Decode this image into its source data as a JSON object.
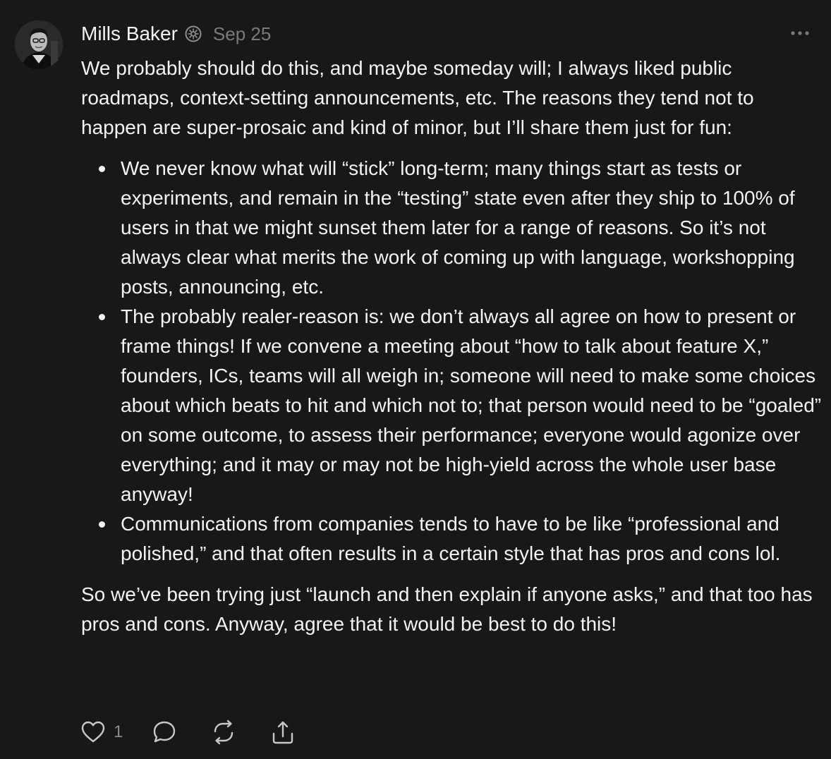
{
  "author": {
    "name": "Mills Baker",
    "date": "Sep 25",
    "verified": true
  },
  "post": {
    "intro": "We probably should do this, and maybe someday will; I always liked public roadmaps, context-setting announcements, etc. The reasons they tend not to happen are super-prosaic and kind of minor, but I’ll share them just for fun:",
    "bullets": [
      "We never know what will “stick” long-term; many things start as tests or experiments, and remain in the “testing” state even after they ship to 100% of users in that we might sunset them later for a range of reasons. So it’s not always clear what merits the work of coming up with language, workshopping posts, announcing, etc.",
      "The probably realer-reason is: we don’t always all agree on how to present or frame things! If we convene a meeting about “how to talk about feature X,” founders, ICs, teams will all weigh in; someone will need to make some choices about which beats to hit and which not to; that person would need to be “goaled” on some outcome, to assess their performance; everyone would agonize over everything; and it may or may not be high-yield across the whole user base anyway!",
      "Communications from companies tends to have to be like “professional and polished,” and that often results in a certain style that has pros and cons lol."
    ],
    "outro": "So we’ve been trying just “launch and then explain if anyone asks,” and that too has pros and cons. Anyway, agree that it would be best to do this!"
  },
  "actions": {
    "like_count": "1"
  },
  "icons": {
    "verified": "verified-badge-icon",
    "more": "more-options-icon",
    "like": "heart-icon",
    "comment": "comment-bubble-icon",
    "repost": "repost-icon",
    "share": "share-icon"
  },
  "colors": {
    "background": "#181818",
    "text": "#f3f3f3",
    "muted": "#7a7a7a"
  }
}
